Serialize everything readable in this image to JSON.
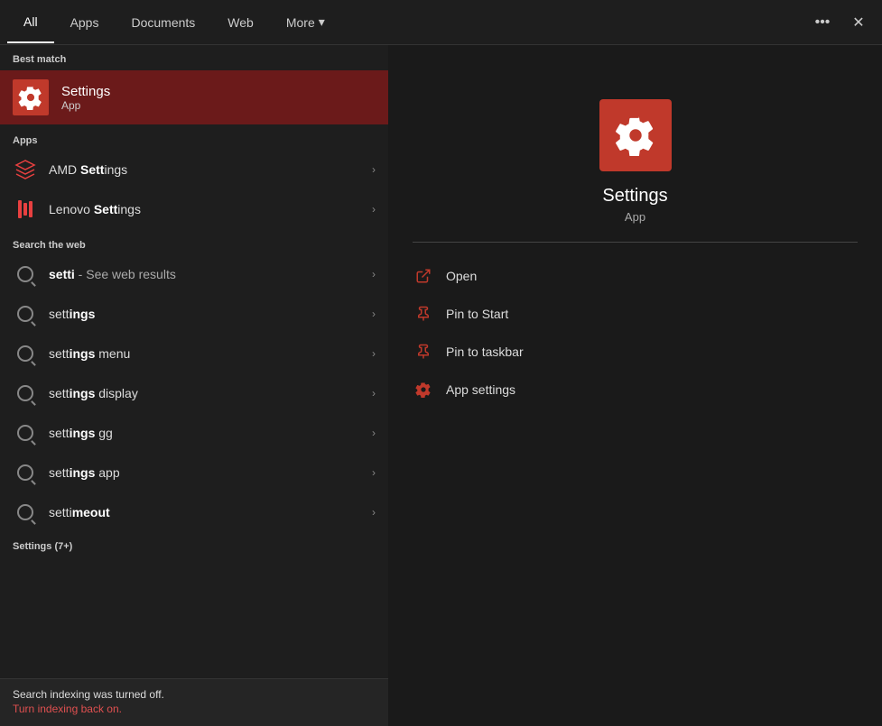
{
  "header": {
    "tabs": [
      {
        "id": "all",
        "label": "All",
        "active": true
      },
      {
        "id": "apps",
        "label": "Apps",
        "active": false
      },
      {
        "id": "documents",
        "label": "Documents",
        "active": false
      },
      {
        "id": "web",
        "label": "Web",
        "active": false
      },
      {
        "id": "more",
        "label": "More",
        "active": false
      }
    ],
    "more_chevron": "▾",
    "ellipsis_label": "•••",
    "close_label": "✕"
  },
  "best_match": {
    "section_label": "Best match",
    "item": {
      "title": "Settings",
      "subtitle": "App"
    }
  },
  "apps_section": {
    "label": "Apps",
    "items": [
      {
        "name_prefix": "AMD ",
        "name_bold": "Sett",
        "name_suffix": "ings"
      },
      {
        "name_prefix": "Lenovo ",
        "name_bold": "Sett",
        "name_suffix": "ings"
      }
    ]
  },
  "web_section": {
    "label": "Search the web",
    "items": [
      {
        "query_prefix": "setti",
        "query_suffix": " - See web results"
      },
      {
        "query_prefix": "sett",
        "query_bold": "ings"
      },
      {
        "query_prefix": "sett",
        "query_bold": "ings",
        "query_rest": " menu"
      },
      {
        "query_prefix": "sett",
        "query_bold": "ings",
        "query_rest": " display"
      },
      {
        "query_prefix": "sett",
        "query_bold": "ings",
        "query_rest": " gg"
      },
      {
        "query_prefix": "sett",
        "query_bold": "ings",
        "query_rest": " app"
      },
      {
        "query_prefix": "setti",
        "query_bold": "meout"
      }
    ]
  },
  "settings_count": {
    "label": "Settings (7+)"
  },
  "bottom_bar": {
    "notification": "Search indexing was turned off.",
    "link": "Turn indexing back on."
  },
  "right_panel": {
    "app_name": "Settings",
    "app_type": "App",
    "actions": [
      {
        "id": "open",
        "label": "Open"
      },
      {
        "id": "pin-start",
        "label": "Pin to Start"
      },
      {
        "id": "pin-taskbar",
        "label": "Pin to taskbar"
      },
      {
        "id": "app-settings",
        "label": "App settings"
      }
    ]
  }
}
